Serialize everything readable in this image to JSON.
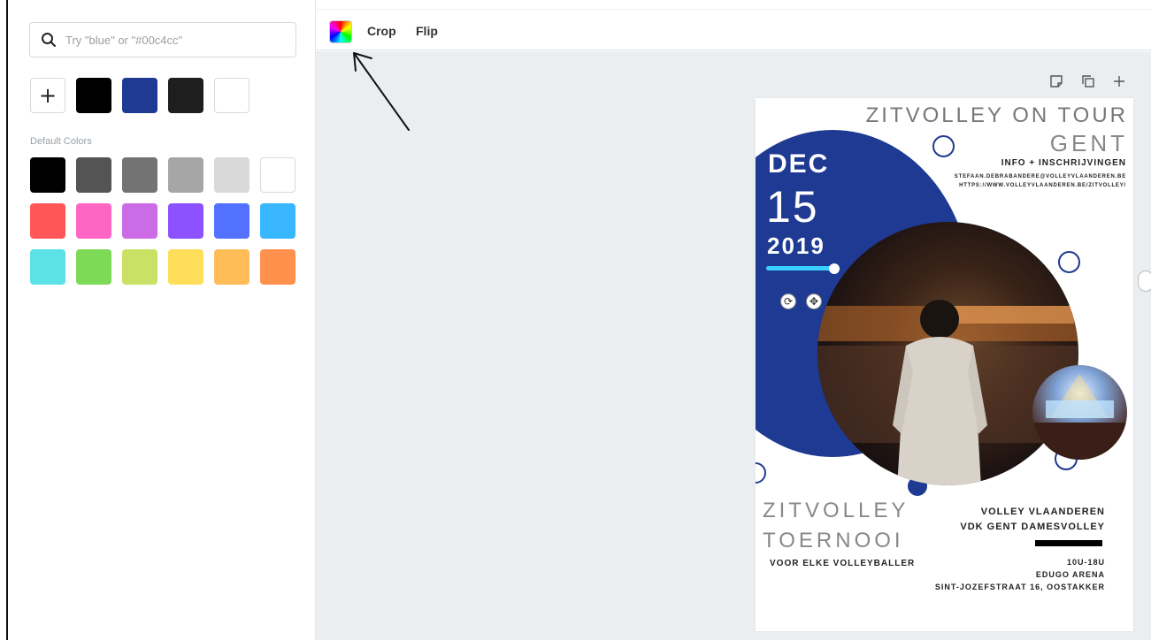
{
  "search": {
    "placeholder": "Try \"blue\" or \"#00c4cc\""
  },
  "document_colors": {
    "add_label": "+",
    "swatches": [
      "#000000",
      "#1f3a93",
      "#1e1e1e",
      "#ffffff"
    ]
  },
  "default_colors": {
    "label": "Default Colors",
    "rows": [
      [
        "#000000",
        "#545454",
        "#737373",
        "#a6a6a6",
        "#d9d9d9",
        "#ffffff"
      ],
      [
        "#ff5757",
        "#ff66c4",
        "#cb6ce6",
        "#8c52ff",
        "#5271ff",
        "#38b6ff"
      ],
      [
        "#5ce1e6",
        "#7ed957",
        "#c9e265",
        "#ffde59",
        "#ffbd59",
        "#ff914d"
      ]
    ]
  },
  "toolbar": {
    "crop": "Crop",
    "flip": "Flip"
  },
  "page_icons": [
    "note-icon",
    "duplicate-icon",
    "add-page-icon"
  ],
  "poster": {
    "title": "ZITVOLLEY ON TOUR",
    "city": "GENT",
    "info": "INFO + INSCHRIJVINGEN",
    "email": "STEFAAN.DEBRABANDERE@VOLLEYVLAANDEREN.BE",
    "url": "HTTPS://WWW.VOLLEYVLAANDEREN.BE/ZITVOLLEY/",
    "month": "DEC",
    "day": "15",
    "year": "2019",
    "event1": "ZITVOLLEY",
    "event2": "TOERNOOI",
    "tagline": "VOOR ELKE VOLLEYBALLER",
    "org1": "VOLLEY VLAANDEREN",
    "org2": "VDK GENT DAMESVOLLEY",
    "time": "10U-18U",
    "venue": "EDUGO ARENA",
    "address": "SINT-JOZEFSTRAAT 16, OOSTAKKER",
    "accent_color": "#1f3a93"
  }
}
